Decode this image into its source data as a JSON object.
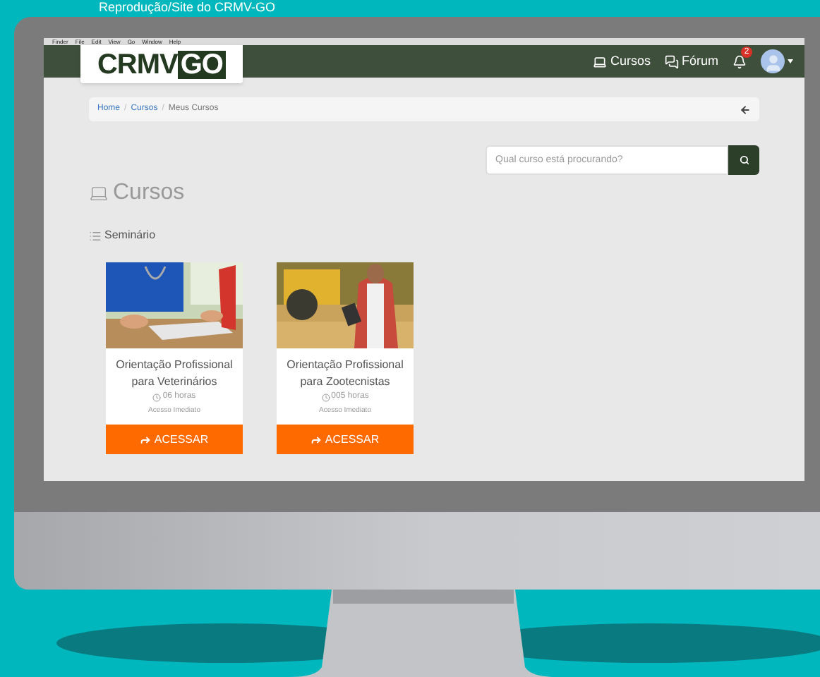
{
  "caption": "Reprodução/Site do CRMV-GO",
  "menubar": {
    "items": [
      "Finder",
      "File",
      "Edit",
      "View",
      "Go",
      "Window",
      "Help"
    ]
  },
  "header": {
    "logo": {
      "left": "CRMV",
      "right": "GO"
    },
    "nav": [
      {
        "label": "Cursos",
        "kind": "laptop"
      },
      {
        "label": "Fórum",
        "kind": "chat"
      }
    ],
    "notifications": {
      "count": "2"
    }
  },
  "breadcrumb_separator": "/",
  "breadcrumb": [
    {
      "label": "Home",
      "selected": false
    },
    {
      "label": "Cursos",
      "selected": false
    },
    {
      "label": "Meus Cursos",
      "selected": true
    }
  ],
  "search": {
    "placeholder": "Qual curso está procurando?"
  },
  "title": "Cursos",
  "section": "Seminário",
  "courses": [
    {
      "title": "Orientação Profissional para Veterinários",
      "duration": "06 horas",
      "access": "Acesso Imediato",
      "button": "ACESSAR"
    },
    {
      "title": "Orientação Profissional para Zootecnistas",
      "duration": "005 horas",
      "access": "Acesso Imediato",
      "button": "ACESSAR"
    }
  ]
}
